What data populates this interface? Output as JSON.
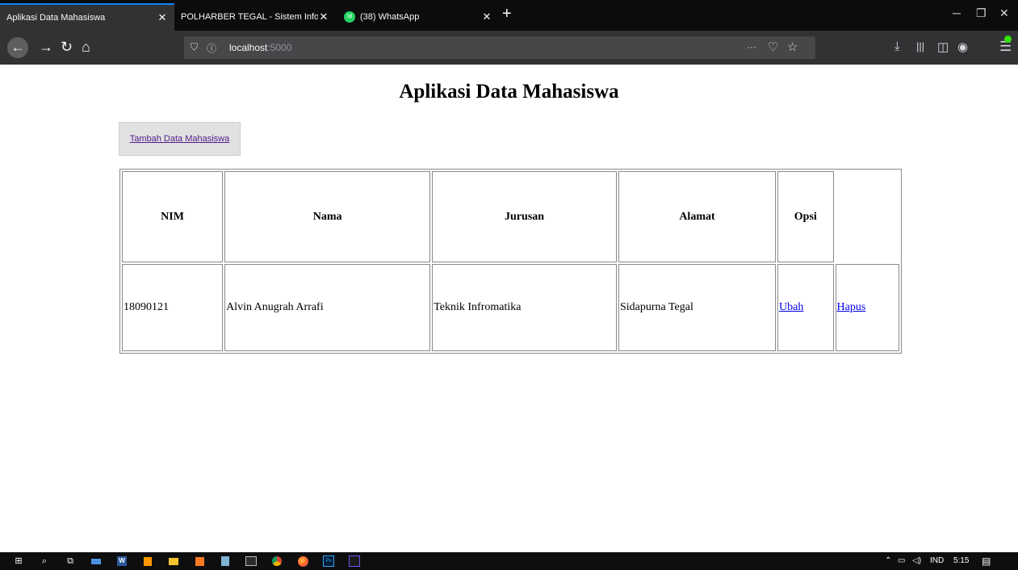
{
  "browser": {
    "tabs": [
      {
        "label": "Aplikasi Data Mahasiswa",
        "active": true
      },
      {
        "label": "POLHARBER TEGAL - Sistem Inform",
        "active": false
      },
      {
        "label": "(38) WhatsApp",
        "active": false,
        "badge": "38"
      }
    ],
    "close_glyph": "✕",
    "new_tab_glyph": "+",
    "url_host": "localhost",
    "url_port": ":5000",
    "page_actions_glyph": "···",
    "icons": {
      "back": "back-arrow-icon",
      "forward": "forward-arrow-icon",
      "reload": "reload-icon",
      "home": "home-icon",
      "shield": "tracking-shield-icon",
      "info": "site-info-icon",
      "pocket": "pocket-icon",
      "bookmark": "bookmark-star-icon",
      "download": "download-icon",
      "library": "library-icon",
      "sidebar": "sidebar-icon",
      "account": "account-icon",
      "menu": "hamburger-menu-icon"
    }
  },
  "page": {
    "title": "Aplikasi Data Mahasiswa",
    "add_button_label": "Tambah Data Mahasiswa",
    "table": {
      "headers": [
        "NIM",
        "Nama",
        "Jurusan",
        "Alamat",
        "Opsi",
        ""
      ],
      "rows": [
        {
          "nim": "18090121",
          "nama": "Alvin Anugrah Arrafi",
          "jurusan": "Teknik Infromatika",
          "alamat": "Sidapurna Tegal",
          "edit_label": "Ubah",
          "delete_label": "Hapus"
        }
      ]
    }
  },
  "taskbar": {
    "tray_language": "IND",
    "tray_time": "5:15",
    "apps": [
      "windows-start",
      "search",
      "task-view",
      "keyboard",
      "word",
      "sublime",
      "file-explorer",
      "xampp",
      "notepad",
      "terminal",
      "chrome",
      "firefox",
      "photoshop",
      "jetbrains"
    ],
    "word_letter": "W",
    "ps_letters": "Ps"
  },
  "colors": {
    "tab_bar": "#0c0c0d",
    "nav_bar": "#323234",
    "active_tab_accent": "#0a84ff",
    "visited_link": "#551a8b",
    "link": "#0000ee"
  }
}
